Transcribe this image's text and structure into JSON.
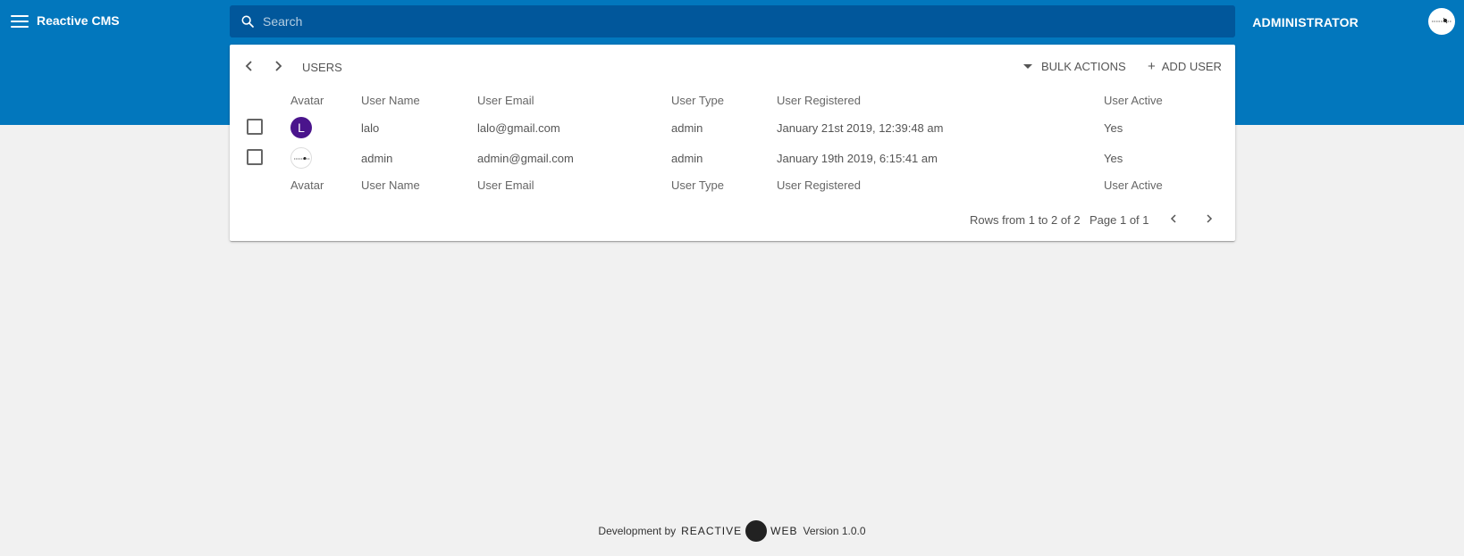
{
  "header": {
    "app_title": "Reactive CMS",
    "search_placeholder": "Search",
    "user_role": "ADMINISTRATOR"
  },
  "card": {
    "title": "USERS",
    "bulk_actions_label": "BULK ACTIONS",
    "add_user_label": "ADD USER"
  },
  "table": {
    "columns": [
      "Avatar",
      "User Name",
      "User Email",
      "User Type",
      "User Registered",
      "User Active"
    ],
    "rows": [
      {
        "avatar_letter": "L",
        "name": "lalo",
        "email": "lalo@gmail.com",
        "type": "admin",
        "registered": "January 21st 2019, 12:39:48 am",
        "active": "Yes"
      },
      {
        "avatar_letter": "",
        "name": "admin",
        "email": "admin@gmail.com",
        "type": "admin",
        "registered": "January 19th 2019, 6:15:41 am",
        "active": "Yes"
      }
    ]
  },
  "pagination": {
    "rows_text": "Rows from 1 to 2 of 2",
    "page_text": "Page 1 of 1"
  },
  "footer": {
    "prefix": "Development by",
    "brand_left": "REACTIVE",
    "brand_right": "WEB",
    "version": "Version 1.0.0"
  },
  "colors": {
    "appbar": "#0277bd",
    "search": "#01579b",
    "avatar_l": "#4a148c"
  }
}
